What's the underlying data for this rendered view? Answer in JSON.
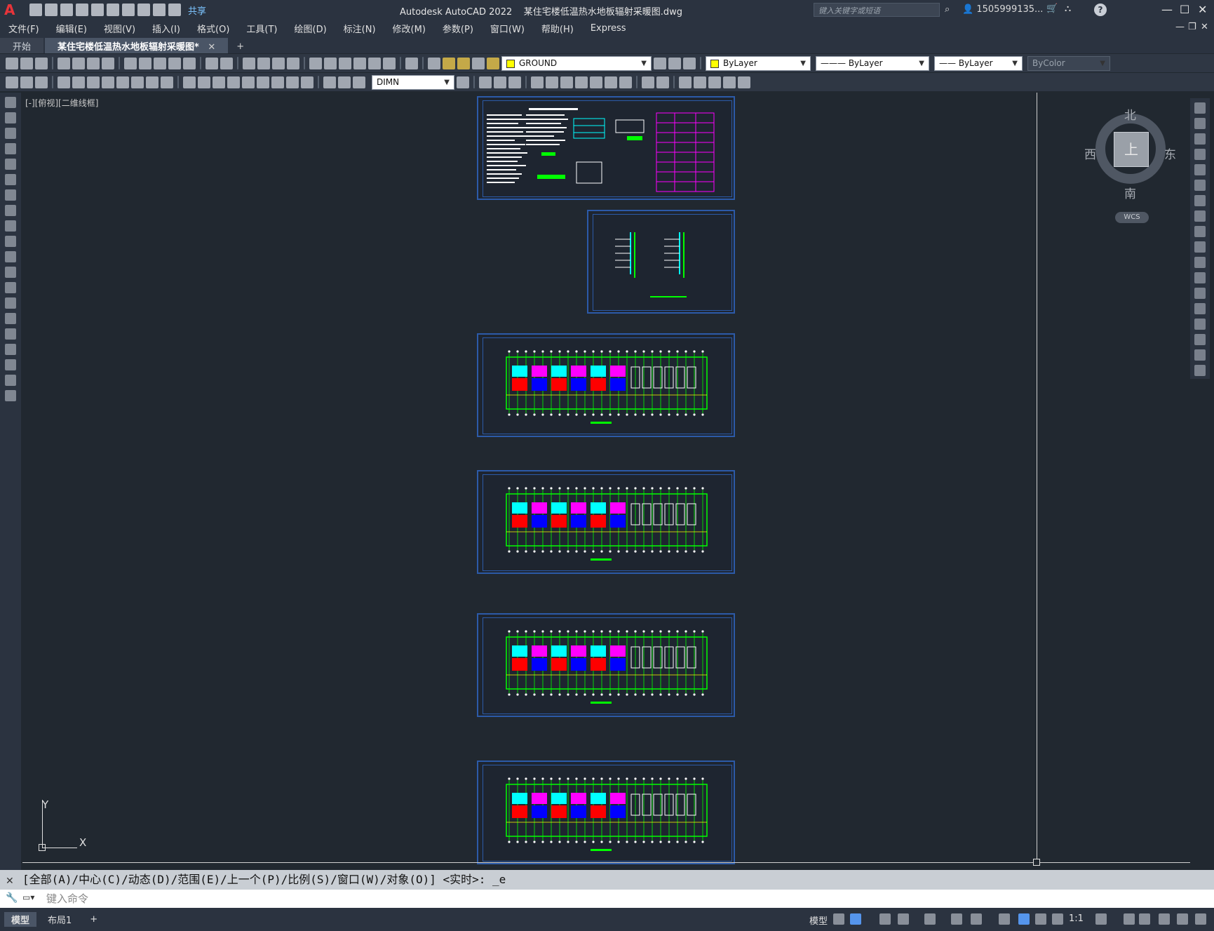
{
  "title_bar": {
    "app_title": "Autodesk AutoCAD 2022",
    "file_name": "某住宅楼低温热水地板辐射采暖图.dwg",
    "share_label": "共享",
    "search_placeholder": "键入关键字或短语",
    "user_name": "1505999135...",
    "min_symbol": "—",
    "restore_symbol": "☐",
    "close_symbol": "✕"
  },
  "menu": [
    "文件(F)",
    "编辑(E)",
    "视图(V)",
    "插入(I)",
    "格式(O)",
    "工具(T)",
    "绘图(D)",
    "标注(N)",
    "修改(M)",
    "参数(P)",
    "窗口(W)",
    "帮助(H)",
    "Express"
  ],
  "tabs": {
    "start": "开始",
    "active": "某住宅楼低温热水地板辐射采暖图*",
    "close": "✕",
    "add": "+"
  },
  "toolbar": {
    "layer": "GROUND",
    "color": "ByLayer",
    "linetype": "ByLayer",
    "lineweight": "ByLayer",
    "plotstyle": "ByColor",
    "dimstyle": "DIMN"
  },
  "viewport": {
    "label": "[-][俯视][二维线框]"
  },
  "viewcube": {
    "north": "北",
    "south": "南",
    "east": "东",
    "west": "西",
    "top": "上",
    "wcs": "WCS"
  },
  "ucs": {
    "x": "X",
    "y": "Y"
  },
  "command": {
    "history": "[全部(A)/中心(C)/动态(D)/范围(E)/上一个(P)/比例(S)/窗口(W)/对象(O)] <实时>: _e",
    "placeholder": "键入命令"
  },
  "status": {
    "model_tab": "模型",
    "layout_tab": "布局1",
    "add": "+",
    "model_btn": "模型",
    "scale": "1:1"
  },
  "left_tools": [
    "line-icon",
    "polyline-icon",
    "polyline-arc-icon",
    "polygon-icon",
    "rectangle-icon",
    "arc-icon",
    "circle-icon",
    "revcloud-icon",
    "spline-icon",
    "ellipse-icon",
    "ellipse-arc-icon",
    "insert-block-icon",
    "make-block-icon",
    "point-icon",
    "hatch-icon",
    "gradient-icon",
    "region-icon",
    "table-icon",
    "mtext-icon",
    "add-selected-icon"
  ],
  "right_tools": [
    "erase-icon",
    "copy-icon",
    "mirror-icon",
    "offset-icon",
    "array-icon",
    "move-icon",
    "rotate-icon",
    "scale-icon",
    "stretch-icon",
    "trim-icon",
    "extend-icon",
    "break-at-point-icon",
    "break-icon",
    "join-icon",
    "chamfer-icon",
    "fillet-icon",
    "blend-icon",
    "explode-icon"
  ]
}
